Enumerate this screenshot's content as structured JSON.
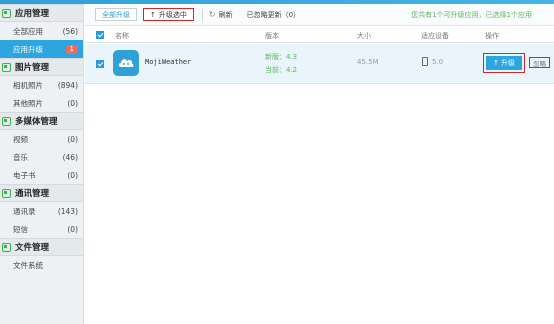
{
  "sidebar": {
    "sections": [
      {
        "title": "应用管理",
        "icon": "grid-icon",
        "items": [
          {
            "label": "全部应用",
            "count": "(56)"
          },
          {
            "label": "应用升级",
            "badge": "1",
            "active": true
          }
        ]
      },
      {
        "title": "图片管理",
        "icon": "image-icon",
        "items": [
          {
            "label": "相机照片",
            "count": "(894)"
          },
          {
            "label": "其他照片",
            "count": "(0)"
          }
        ]
      },
      {
        "title": "多媒体管理",
        "icon": "media-icon",
        "items": [
          {
            "label": "视频",
            "count": "(0)"
          },
          {
            "label": "音乐",
            "count": "(46)"
          },
          {
            "label": "电子书",
            "count": "(0)"
          }
        ]
      },
      {
        "title": "通讯管理",
        "icon": "contact-icon",
        "items": [
          {
            "label": "通讯录",
            "count": "(143)"
          },
          {
            "label": "短信",
            "count": "(0)"
          }
        ]
      },
      {
        "title": "文件管理",
        "icon": "folder-icon",
        "items": [
          {
            "label": "文件系统",
            "count": ""
          }
        ]
      }
    ]
  },
  "toolbar": {
    "upgrade_all": "全部升级",
    "upgrade_selected": "升级选中",
    "refresh": "刷新",
    "ignored_updates": "已忽略更新（0）",
    "status_text": "您共有1个可升级应用，已选择1个应用"
  },
  "table": {
    "headers": {
      "name": "名称",
      "version": "版本",
      "size": "大小",
      "device": "适应设备",
      "action": "操作"
    },
    "rows": [
      {
        "name": "MojiWeather",
        "version_new": "新版：4.3",
        "version_current": "当前：4.2",
        "size": "45.5M",
        "device": "5.0",
        "upgrade_label": "升级",
        "ignore_label": "忽略"
      }
    ]
  },
  "colors": {
    "accent": "#2da5df",
    "highlight_border": "#cc2b2b",
    "status_green": "#5cb85c",
    "badge": "#f06a57"
  }
}
